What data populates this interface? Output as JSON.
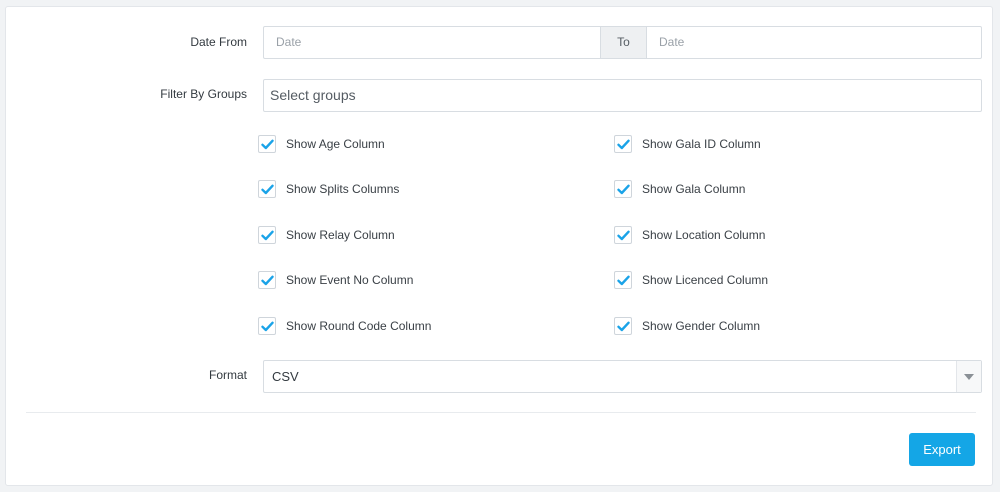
{
  "date_range": {
    "label": "Date From",
    "from_placeholder": "Date",
    "separator": "To",
    "to_placeholder": "Date"
  },
  "groups": {
    "label": "Filter By Groups",
    "placeholder": "Select groups"
  },
  "columns_left": [
    {
      "label": "Show Age Column",
      "checked": true
    },
    {
      "label": "Show Splits Columns",
      "checked": true
    },
    {
      "label": "Show Relay Column",
      "checked": true
    },
    {
      "label": "Show Event No Column",
      "checked": true
    },
    {
      "label": "Show Round Code Column",
      "checked": true
    }
  ],
  "columns_right": [
    {
      "label": "Show Gala ID Column",
      "checked": true
    },
    {
      "label": "Show Gala Column",
      "checked": true
    },
    {
      "label": "Show Location Column",
      "checked": true
    },
    {
      "label": "Show Licenced Column",
      "checked": true
    },
    {
      "label": "Show Gender Column",
      "checked": true
    }
  ],
  "format": {
    "label": "Format",
    "value": "CSV"
  },
  "actions": {
    "export_label": "Export"
  },
  "colors": {
    "accent": "#14a6e6",
    "check": "#1aa3e8"
  },
  "icons": {
    "check": "check-icon",
    "caret": "caret-down-icon"
  }
}
